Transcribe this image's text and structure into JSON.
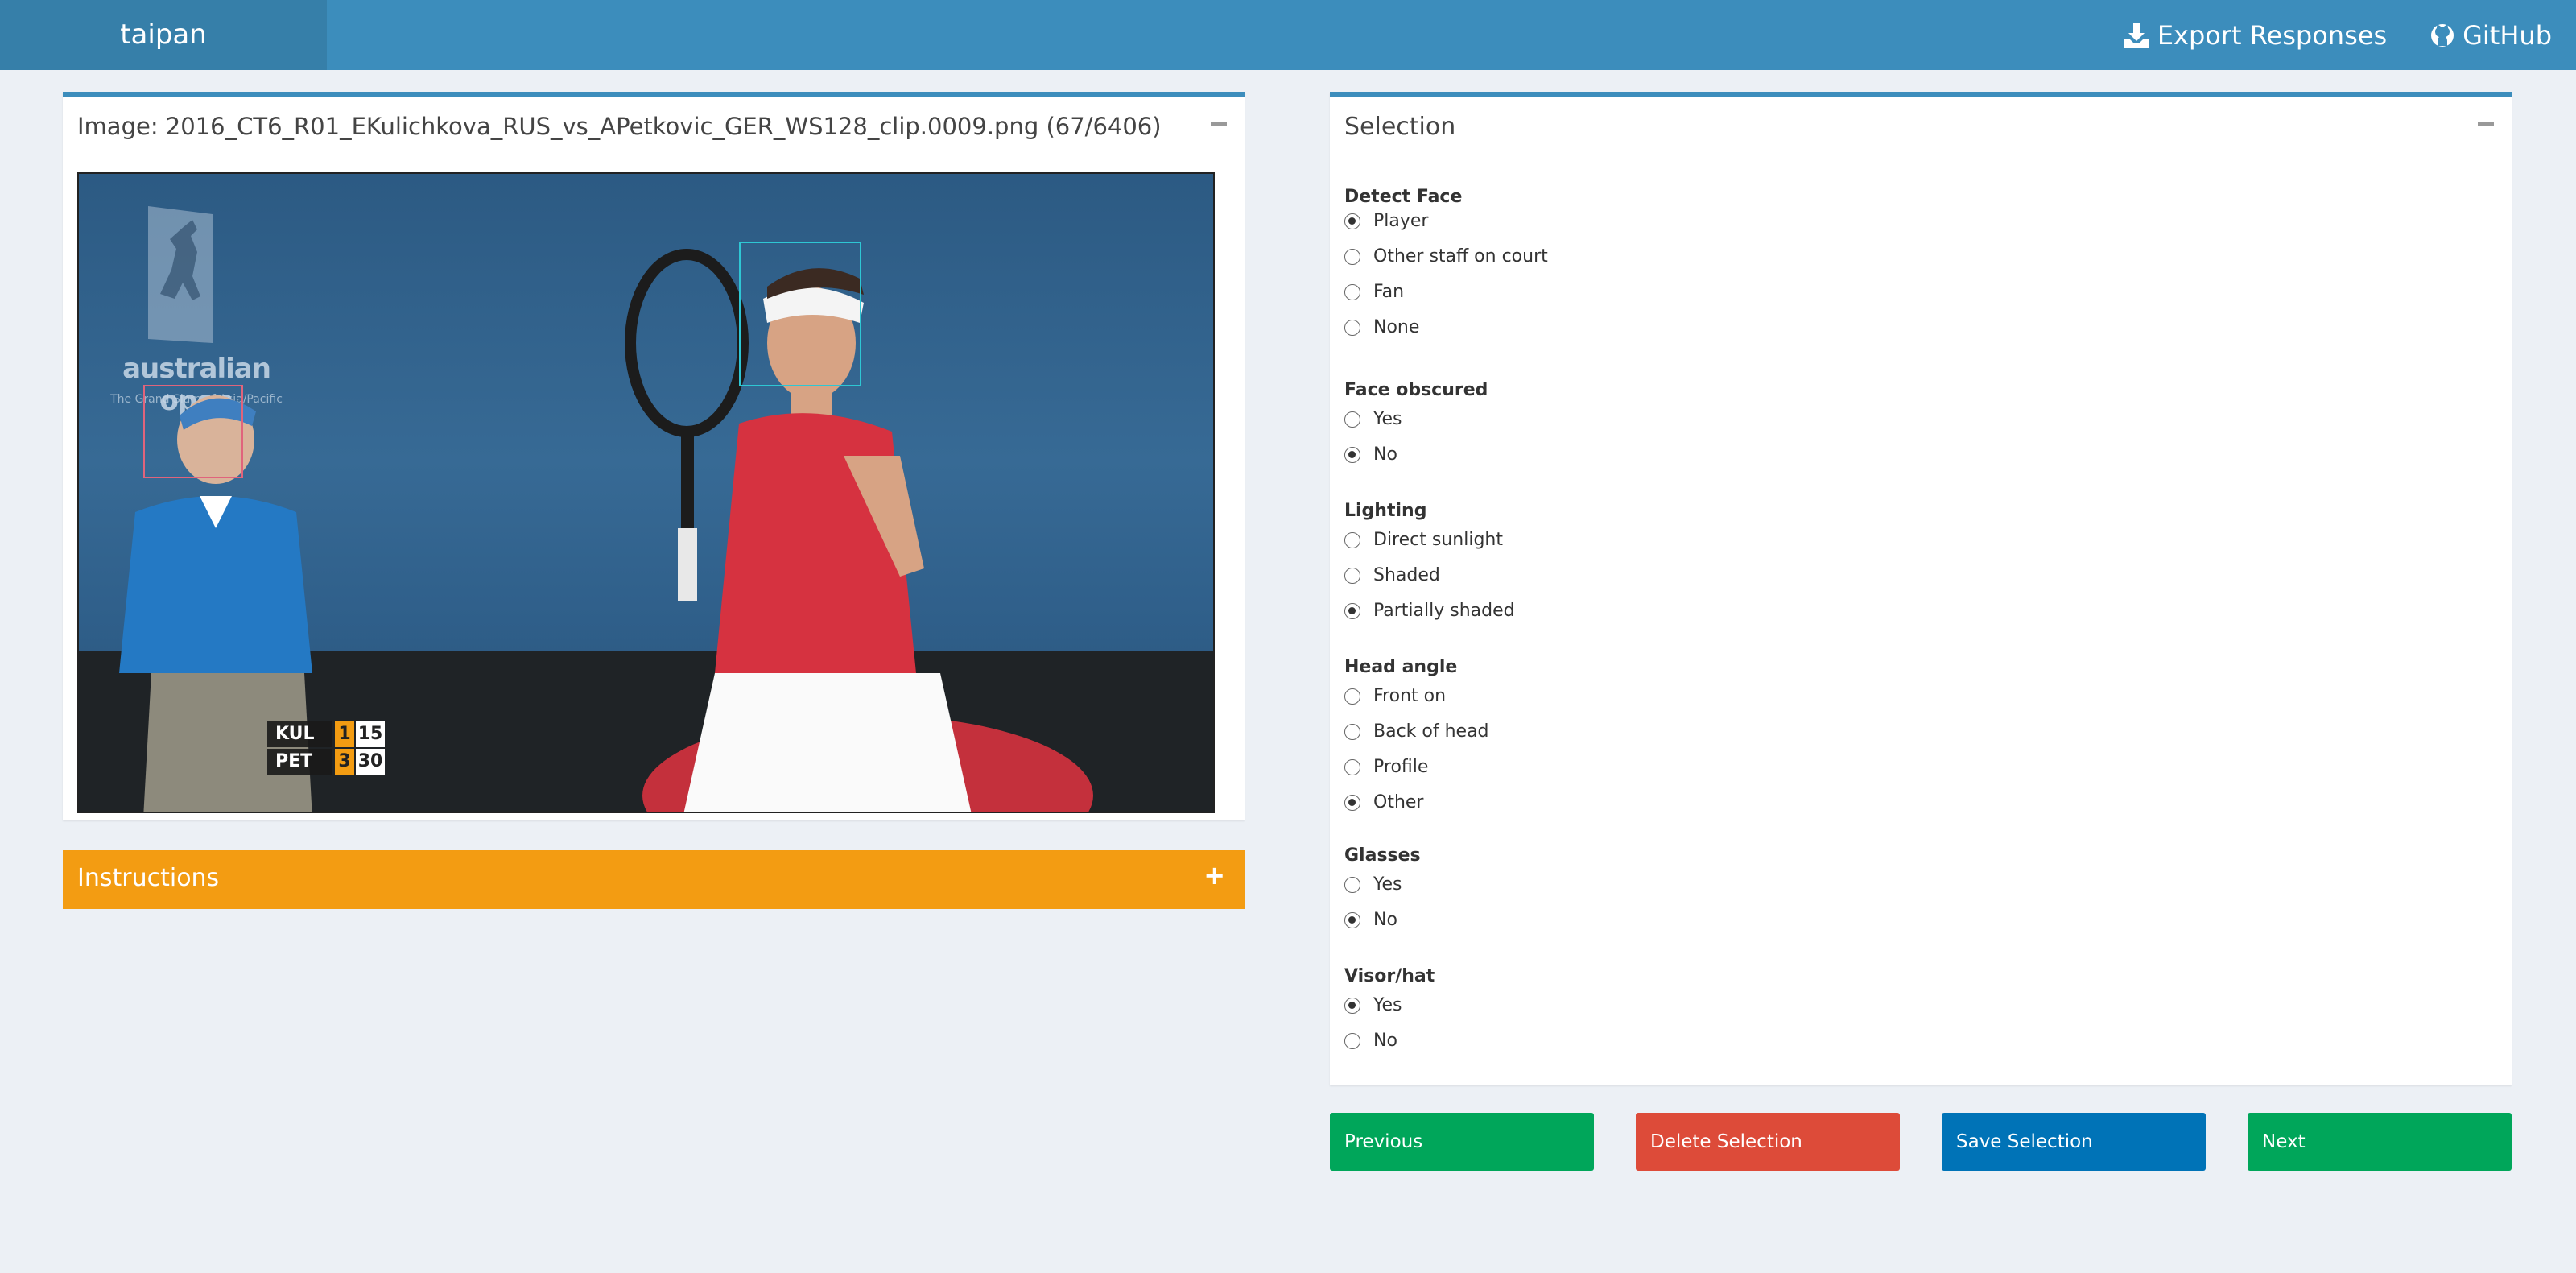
{
  "header": {
    "app_title": "taipan",
    "export_label": "Export Responses",
    "github_label": "GitHub",
    "accent_color": "#3c8dbc"
  },
  "image_panel": {
    "title": "Image: 2016_CT6_R01_EKulichkova_RUS_vs_APetkovic_GER_WS128_clip.0009.png (67/6406)",
    "collapse_icon": "minus-icon",
    "scene": {
      "logo_text": "australian open",
      "logo_subtext": "The Grand Slam of Asia/Pacific",
      "scoreboard": [
        {
          "name": "KUL",
          "set": "1",
          "points": "15"
        },
        {
          "name": "PET",
          "set": "3",
          "points": "30"
        }
      ]
    }
  },
  "instructions": {
    "title": "Instructions",
    "expand_icon": "plus-icon",
    "color": "#f39c12"
  },
  "selection": {
    "title": "Selection",
    "collapse_icon": "minus-icon",
    "groups": [
      {
        "label": "Detect Face",
        "options": [
          "Player",
          "Other staff on court",
          "Fan",
          "None"
        ],
        "selected": "Player"
      },
      {
        "label": "Face obscured",
        "options": [
          "Yes",
          "No"
        ],
        "selected": "No"
      },
      {
        "label": "Lighting",
        "options": [
          "Direct sunlight",
          "Shaded",
          "Partially shaded"
        ],
        "selected": "Partially shaded"
      },
      {
        "label": "Head angle",
        "options": [
          "Front on",
          "Back of head",
          "Profile",
          "Other"
        ],
        "selected": "Other"
      },
      {
        "label": "Glasses",
        "options": [
          "Yes",
          "No"
        ],
        "selected": "No"
      },
      {
        "label": "Visor/hat",
        "options": [
          "Yes",
          "No"
        ],
        "selected": "Yes"
      }
    ]
  },
  "buttons": {
    "previous": "Previous",
    "delete": "Delete Selection",
    "save": "Save Selection",
    "next": "Next",
    "colors": {
      "previous": "#00a65a",
      "delete": "#dd4b39",
      "save": "#0073b7",
      "next": "#00a65a"
    }
  }
}
